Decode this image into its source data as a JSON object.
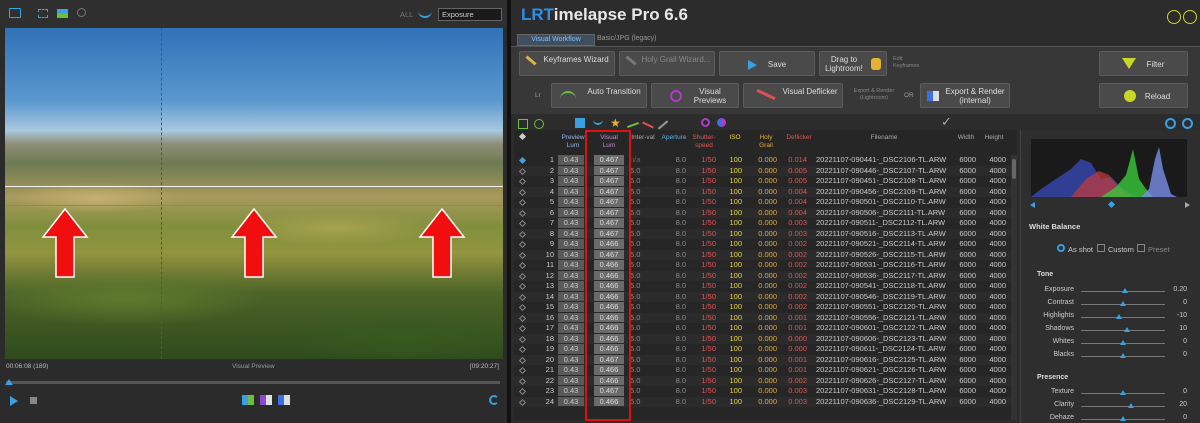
{
  "left": {
    "header": {
      "filter_all": "ALL",
      "dropdown_value": "Exposure"
    },
    "timeline": {
      "start": "00:06:08 (189)",
      "label": "Visual Preview",
      "end": "[09:20:27]"
    }
  },
  "app": {
    "title_accent": "LRT",
    "title_rest": "imelapse Pro 6.6"
  },
  "tabs": [
    "Visual Workflow",
    "Basic/JPG (legacy)"
  ],
  "toolbar": {
    "keyframes_wizard": "Keyframes Wizard",
    "holy_grail_wizard": "Holy Grail Wizard...",
    "save": "Save",
    "drag_to_lr": "Drag to Lightroom!",
    "edit_keyframes": "Edit Keyframes",
    "filter": "Filter",
    "auto_transition": "Auto Transition",
    "visual_previews": "Visual Previews",
    "visual_deflicker": "Visual Deflicker",
    "export_lightroom": "Export & Render (Lightroom)",
    "or": "OR",
    "export_internal": "Export & Render (internal)",
    "reload": "Reload",
    "lr": "Lr"
  },
  "table": {
    "headers": [
      "Preview Lum",
      "Visual Lum",
      "Inter-val",
      "Aperture",
      "Shutter-speed",
      "ISO",
      "Holy Grail",
      "Deflicker",
      "Filename",
      "Width",
      "Height"
    ],
    "rows": [
      [
        "1",
        "0.43",
        "0.467",
        "n/a",
        "8.0",
        "1/50",
        "100",
        "0.000",
        "0.014",
        "20221107-090441-_DSC2106-TL.ARW",
        "6000",
        "4000"
      ],
      [
        "2",
        "0.43",
        "0.467",
        "5.0",
        "8.0",
        "1/50",
        "100",
        "0.000",
        "0.005",
        "20221107-090446-_DSC2107-TL.ARW",
        "6000",
        "4000"
      ],
      [
        "3",
        "0.43",
        "0.467",
        "5.0",
        "8.0",
        "1/50",
        "100",
        "0.000",
        "0.005",
        "20221107-090451-_DSC2108-TL.ARW",
        "6000",
        "4000"
      ],
      [
        "4",
        "0.43",
        "0.467",
        "5.0",
        "8.0",
        "1/50",
        "100",
        "0.000",
        "0.004",
        "20221107-090456-_DSC2109-TL.ARW",
        "6000",
        "4000"
      ],
      [
        "5",
        "0.43",
        "0.467",
        "5.0",
        "8.0",
        "1/50",
        "100",
        "0.000",
        "0.004",
        "20221107-090501-_DSC2110-TL.ARW",
        "6000",
        "4000"
      ],
      [
        "6",
        "0.43",
        "0.467",
        "5.0",
        "8.0",
        "1/50",
        "100",
        "0.000",
        "0.004",
        "20221107-090506-_DSC2111-TL.ARW",
        "6000",
        "4000"
      ],
      [
        "7",
        "0.43",
        "0.467",
        "5.0",
        "8.0",
        "1/50",
        "100",
        "0.000",
        "0.003",
        "20221107-090511-_DSC2112-TL.ARW",
        "6000",
        "4000"
      ],
      [
        "8",
        "0.43",
        "0.467",
        "5.0",
        "8.0",
        "1/50",
        "100",
        "0.000",
        "0.003",
        "20221107-090516-_DSC2113-TL.ARW",
        "6000",
        "4000"
      ],
      [
        "9",
        "0.43",
        "0.466",
        "5.0",
        "8.0",
        "1/50",
        "100",
        "0.000",
        "0.002",
        "20221107-090521-_DSC2114-TL.ARW",
        "6000",
        "4000"
      ],
      [
        "10",
        "0.43",
        "0.467",
        "5.0",
        "8.0",
        "1/50",
        "100",
        "0.000",
        "0.002",
        "20221107-090526-_DSC2115-TL.ARW",
        "6000",
        "4000"
      ],
      [
        "11",
        "0.43",
        "0.466",
        "5.0",
        "8.0",
        "1/50",
        "100",
        "0.000",
        "0.002",
        "20221107-090531-_DSC2116-TL.ARW",
        "6000",
        "4000"
      ],
      [
        "12",
        "0.43",
        "0.466",
        "5.0",
        "8.0",
        "1/50",
        "100",
        "0.000",
        "0.002",
        "20221107-090536-_DSC2117-TL.ARW",
        "6000",
        "4000"
      ],
      [
        "13",
        "0.43",
        "0.466",
        "5.0",
        "8.0",
        "1/50",
        "100",
        "0.000",
        "0.002",
        "20221107-090541-_DSC2118-TL.ARW",
        "6000",
        "4000"
      ],
      [
        "14",
        "0.43",
        "0.466",
        "5.0",
        "8.0",
        "1/50",
        "100",
        "0.000",
        "0.002",
        "20221107-090546-_DSC2119-TL.ARW",
        "6000",
        "4000"
      ],
      [
        "15",
        "0.43",
        "0.466",
        "5.0",
        "8.0",
        "1/50",
        "100",
        "0.000",
        "0.002",
        "20221107-090551-_DSC2120-TL.ARW",
        "6000",
        "4000"
      ],
      [
        "16",
        "0.43",
        "0.466",
        "5.0",
        "8.0",
        "1/50",
        "100",
        "0.000",
        "0.001",
        "20221107-090556-_DSC2121-TL.ARW",
        "6000",
        "4000"
      ],
      [
        "17",
        "0.43",
        "0.466",
        "5.0",
        "8.0",
        "1/50",
        "100",
        "0.000",
        "0.001",
        "20221107-090601-_DSC2122-TL.ARW",
        "6000",
        "4000"
      ],
      [
        "18",
        "0.43",
        "0.466",
        "5.0",
        "8.0",
        "1/50",
        "100",
        "0.000",
        "0.000",
        "20221107-090606-_DSC2123-TL.ARW",
        "6000",
        "4000"
      ],
      [
        "19",
        "0.43",
        "0.466",
        "5.0",
        "8.0",
        "1/50",
        "100",
        "0.000",
        "0.000",
        "20221107-090611-_DSC2124-TL.ARW",
        "6000",
        "4000"
      ],
      [
        "20",
        "0.43",
        "0.467",
        "5.0",
        "8.0",
        "1/50",
        "100",
        "0.000",
        "0.001",
        "20221107-090616-_DSC2125-TL.ARW",
        "6000",
        "4000"
      ],
      [
        "21",
        "0.43",
        "0.466",
        "5.0",
        "8.0",
        "1/50",
        "100",
        "0.000",
        "0.001",
        "20221107-090621-_DSC2126-TL.ARW",
        "6000",
        "4000"
      ],
      [
        "22",
        "0.43",
        "0.466",
        "5.0",
        "8.0",
        "1/50",
        "100",
        "0.000",
        "0.002",
        "20221107-090626-_DSC2127-TL.ARW",
        "6000",
        "4000"
      ],
      [
        "23",
        "0.43",
        "0.467",
        "5.0",
        "8.0",
        "1/50",
        "100",
        "0.000",
        "0.003",
        "20221107-090631-_DSC2128-TL.ARW",
        "6000",
        "4000"
      ],
      [
        "24",
        "0.43",
        "0.466",
        "5.0",
        "8.0",
        "1/50",
        "100",
        "0.000",
        "0.003",
        "20221107-090636-_DSC2129-TL.ARW",
        "6000",
        "4000"
      ]
    ]
  },
  "panel": {
    "white_balance": "White Balance",
    "wb_options": [
      "As shot",
      "Custom",
      "Preset"
    ],
    "tone": "Tone",
    "tone_sliders": [
      {
        "label": "Exposure",
        "value": "0.20",
        "pos": 0.52
      },
      {
        "label": "Contrast",
        "value": "0",
        "pos": 0.5
      },
      {
        "label": "Highlights",
        "value": "-10",
        "pos": 0.45
      },
      {
        "label": "Shadows",
        "value": "10",
        "pos": 0.55
      },
      {
        "label": "Whites",
        "value": "0",
        "pos": 0.5
      },
      {
        "label": "Blacks",
        "value": "0",
        "pos": 0.5
      }
    ],
    "presence": "Presence",
    "presence_sliders": [
      {
        "label": "Texture",
        "value": "0",
        "pos": 0.5
      },
      {
        "label": "Clarity",
        "value": "20",
        "pos": 0.6
      },
      {
        "label": "Dehaze",
        "value": "0",
        "pos": 0.5
      }
    ]
  }
}
